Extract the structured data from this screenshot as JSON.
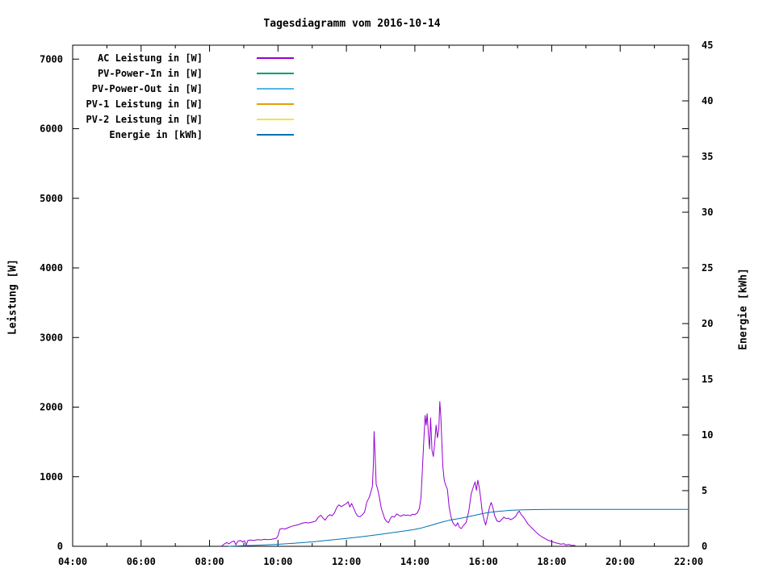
{
  "window": {
    "title": "Tagesdiagramm vom 2016-10-14"
  },
  "chart_data": {
    "type": "line",
    "title": "Tagesdiagramm vom 2016-10-14",
    "grid": false,
    "legend_position": "top-left-inside",
    "x_axis": {
      "range_hours": [
        4,
        22
      ],
      "major_tick_labels": [
        "04:00",
        "06:00",
        "08:00",
        "10:00",
        "12:00",
        "14:00",
        "16:00",
        "18:00",
        "20:00",
        "22:00"
      ],
      "major_tick_hours": [
        4,
        6,
        8,
        10,
        12,
        14,
        16,
        18,
        20,
        22
      ],
      "minor_tick_every_hours": 1
    },
    "y_axis_left": {
      "label": "Leistung [W]",
      "range": [
        0,
        7200
      ],
      "tick_values": [
        0,
        1000,
        2000,
        3000,
        4000,
        5000,
        6000,
        7000
      ],
      "tick_labels": [
        "0",
        "1000",
        "2000",
        "3000",
        "4000",
        "5000",
        "6000",
        "7000"
      ]
    },
    "y_axis_right": {
      "label": "Energie [kWh]",
      "range": [
        0,
        45
      ],
      "tick_values": [
        0,
        5,
        10,
        15,
        20,
        25,
        30,
        35,
        40,
        45
      ],
      "tick_labels": [
        "0",
        "5",
        "10",
        "15",
        "20",
        "25",
        "30",
        "35",
        "40",
        "45"
      ]
    },
    "legend": [
      {
        "label": "AC Leistung in [W]",
        "color": "#9400D3"
      },
      {
        "label": "PV-Power-In in [W]",
        "color": "#009E73"
      },
      {
        "label": "PV-Power-Out in [W]",
        "color": "#56B4E9"
      },
      {
        "label": "PV-1 Leistung in [W]",
        "color": "#E69F00"
      },
      {
        "label": "PV-2 Leistung in [W]",
        "color": "#F0E442"
      },
      {
        "label": "Energie in [kWh]",
        "color": "#0072B2"
      }
    ],
    "series": [
      {
        "name": "AC Leistung in [W]",
        "color": "#9400D3",
        "axis": "left",
        "points": [
          [
            8.35,
            0
          ],
          [
            8.42,
            30
          ],
          [
            8.5,
            55
          ],
          [
            8.57,
            35
          ],
          [
            8.65,
            65
          ],
          [
            8.72,
            75
          ],
          [
            8.77,
            20
          ],
          [
            8.82,
            70
          ],
          [
            8.9,
            85
          ],
          [
            8.97,
            60
          ],
          [
            9.02,
            80
          ],
          [
            9.07,
            15
          ],
          [
            9.12,
            85
          ],
          [
            9.2,
            90
          ],
          [
            9.3,
            85
          ],
          [
            9.4,
            95
          ],
          [
            9.5,
            92
          ],
          [
            9.6,
            100
          ],
          [
            9.7,
            96
          ],
          [
            9.8,
            100
          ],
          [
            9.88,
            108
          ],
          [
            9.95,
            115
          ],
          [
            10.0,
            150
          ],
          [
            10.05,
            245
          ],
          [
            10.12,
            255
          ],
          [
            10.2,
            248
          ],
          [
            10.3,
            268
          ],
          [
            10.4,
            288
          ],
          [
            10.5,
            300
          ],
          [
            10.6,
            312
          ],
          [
            10.7,
            330
          ],
          [
            10.8,
            342
          ],
          [
            10.9,
            336
          ],
          [
            11.0,
            348
          ],
          [
            11.1,
            362
          ],
          [
            11.18,
            420
          ],
          [
            11.25,
            445
          ],
          [
            11.32,
            405
          ],
          [
            11.38,
            375
          ],
          [
            11.45,
            430
          ],
          [
            11.52,
            455
          ],
          [
            11.58,
            438
          ],
          [
            11.65,
            480
          ],
          [
            11.72,
            560
          ],
          [
            11.78,
            595
          ],
          [
            11.85,
            570
          ],
          [
            11.92,
            590
          ],
          [
            12.0,
            615
          ],
          [
            12.05,
            640
          ],
          [
            12.1,
            565
          ],
          [
            12.15,
            615
          ],
          [
            12.2,
            560
          ],
          [
            12.27,
            480
          ],
          [
            12.33,
            432
          ],
          [
            12.4,
            425
          ],
          [
            12.47,
            455
          ],
          [
            12.53,
            490
          ],
          [
            12.6,
            640
          ],
          [
            12.67,
            705
          ],
          [
            12.72,
            790
          ],
          [
            12.76,
            860
          ],
          [
            12.79,
            1200
          ],
          [
            12.81,
            1650
          ],
          [
            12.84,
            1300
          ],
          [
            12.87,
            890
          ],
          [
            12.92,
            810
          ],
          [
            12.97,
            690
          ],
          [
            13.02,
            545
          ],
          [
            13.07,
            470
          ],
          [
            13.12,
            395
          ],
          [
            13.18,
            355
          ],
          [
            13.23,
            340
          ],
          [
            13.28,
            395
          ],
          [
            13.33,
            430
          ],
          [
            13.4,
            420
          ],
          [
            13.47,
            465
          ],
          [
            13.53,
            445
          ],
          [
            13.6,
            432
          ],
          [
            13.67,
            455
          ],
          [
            13.73,
            445
          ],
          [
            13.8,
            450
          ],
          [
            13.87,
            438
          ],
          [
            13.93,
            460
          ],
          [
            14.0,
            455
          ],
          [
            14.07,
            480
          ],
          [
            14.13,
            540
          ],
          [
            14.18,
            700
          ],
          [
            14.22,
            1100
          ],
          [
            14.26,
            1500
          ],
          [
            14.3,
            1880
          ],
          [
            14.33,
            1740
          ],
          [
            14.36,
            1905
          ],
          [
            14.4,
            1590
          ],
          [
            14.43,
            1400
          ],
          [
            14.46,
            1845
          ],
          [
            14.5,
            1380
          ],
          [
            14.54,
            1290
          ],
          [
            14.58,
            1490
          ],
          [
            14.62,
            1740
          ],
          [
            14.66,
            1560
          ],
          [
            14.7,
            1690
          ],
          [
            14.73,
            2080
          ],
          [
            14.76,
            1860
          ],
          [
            14.79,
            1470
          ],
          [
            14.82,
            1140
          ],
          [
            14.86,
            950
          ],
          [
            14.9,
            880
          ],
          [
            14.95,
            820
          ],
          [
            15.0,
            570
          ],
          [
            15.05,
            435
          ],
          [
            15.1,
            350
          ],
          [
            15.15,
            312
          ],
          [
            15.2,
            292
          ],
          [
            15.25,
            338
          ],
          [
            15.3,
            272
          ],
          [
            15.36,
            255
          ],
          [
            15.42,
            300
          ],
          [
            15.5,
            342
          ],
          [
            15.58,
            520
          ],
          [
            15.65,
            760
          ],
          [
            15.72,
            870
          ],
          [
            15.76,
            925
          ],
          [
            15.8,
            805
          ],
          [
            15.84,
            950
          ],
          [
            15.88,
            850
          ],
          [
            15.92,
            705
          ],
          [
            15.97,
            490
          ],
          [
            16.02,
            385
          ],
          [
            16.07,
            305
          ],
          [
            16.12,
            420
          ],
          [
            16.18,
            560
          ],
          [
            16.23,
            630
          ],
          [
            16.28,
            560
          ],
          [
            16.33,
            440
          ],
          [
            16.4,
            365
          ],
          [
            16.47,
            352
          ],
          [
            16.53,
            382
          ],
          [
            16.6,
            418
          ],
          [
            16.67,
            398
          ],
          [
            16.73,
            405
          ],
          [
            16.8,
            382
          ],
          [
            16.88,
            402
          ],
          [
            16.95,
            432
          ],
          [
            17.0,
            480
          ],
          [
            17.05,
            505
          ],
          [
            17.1,
            462
          ],
          [
            17.17,
            420
          ],
          [
            17.23,
            378
          ],
          [
            17.3,
            322
          ],
          [
            17.38,
            282
          ],
          [
            17.46,
            242
          ],
          [
            17.54,
            205
          ],
          [
            17.62,
            168
          ],
          [
            17.7,
            140
          ],
          [
            17.78,
            118
          ],
          [
            17.86,
            95
          ],
          [
            17.94,
            80
          ],
          [
            18.02,
            65
          ],
          [
            18.1,
            52
          ],
          [
            18.18,
            42
          ],
          [
            18.27,
            30
          ],
          [
            18.35,
            38
          ],
          [
            18.42,
            18
          ],
          [
            18.5,
            28
          ],
          [
            18.58,
            12
          ],
          [
            18.65,
            15
          ],
          [
            18.72,
            0
          ]
        ]
      },
      {
        "name": "PV-Power-In in [W]",
        "color": "#009E73",
        "axis": "left",
        "points": []
      },
      {
        "name": "PV-Power-Out in [W]",
        "color": "#56B4E9",
        "axis": "left",
        "points": []
      },
      {
        "name": "PV-1 Leistung in [W]",
        "color": "#E69F00",
        "axis": "left",
        "points": []
      },
      {
        "name": "PV-2 Leistung in [W]",
        "color": "#F0E442",
        "axis": "left",
        "points": []
      },
      {
        "name": "Energie in [kWh]",
        "color": "#0072B2",
        "axis": "right",
        "points": [
          [
            8.55,
            0
          ],
          [
            9.0,
            0.05
          ],
          [
            9.5,
            0.11
          ],
          [
            10.0,
            0.18
          ],
          [
            10.5,
            0.28
          ],
          [
            11.0,
            0.4
          ],
          [
            11.5,
            0.55
          ],
          [
            12.0,
            0.7
          ],
          [
            12.5,
            0.88
          ],
          [
            13.0,
            1.08
          ],
          [
            13.5,
            1.3
          ],
          [
            13.8,
            1.42
          ],
          [
            14.0,
            1.52
          ],
          [
            14.2,
            1.65
          ],
          [
            14.4,
            1.82
          ],
          [
            14.6,
            2.0
          ],
          [
            14.8,
            2.18
          ],
          [
            15.0,
            2.33
          ],
          [
            15.2,
            2.45
          ],
          [
            15.4,
            2.55
          ],
          [
            15.6,
            2.68
          ],
          [
            15.8,
            2.82
          ],
          [
            16.0,
            2.95
          ],
          [
            16.2,
            3.05
          ],
          [
            16.4,
            3.12
          ],
          [
            16.6,
            3.18
          ],
          [
            16.8,
            3.23
          ],
          [
            17.0,
            3.26
          ],
          [
            17.2,
            3.28
          ],
          [
            17.5,
            3.3
          ],
          [
            18.0,
            3.31
          ],
          [
            19.0,
            3.31
          ],
          [
            20.0,
            3.31
          ],
          [
            21.0,
            3.31
          ],
          [
            22.0,
            3.31
          ]
        ]
      }
    ]
  }
}
